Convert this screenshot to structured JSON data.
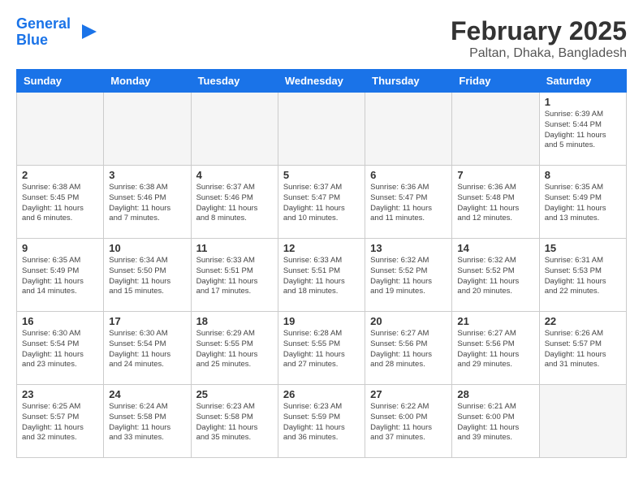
{
  "header": {
    "logo_line1": "General",
    "logo_line2": "Blue",
    "month": "February 2025",
    "location": "Paltan, Dhaka, Bangladesh"
  },
  "weekdays": [
    "Sunday",
    "Monday",
    "Tuesday",
    "Wednesday",
    "Thursday",
    "Friday",
    "Saturday"
  ],
  "weeks": [
    [
      {
        "day": "",
        "info": ""
      },
      {
        "day": "",
        "info": ""
      },
      {
        "day": "",
        "info": ""
      },
      {
        "day": "",
        "info": ""
      },
      {
        "day": "",
        "info": ""
      },
      {
        "day": "",
        "info": ""
      },
      {
        "day": "1",
        "info": "Sunrise: 6:39 AM\nSunset: 5:44 PM\nDaylight: 11 hours and 5 minutes."
      }
    ],
    [
      {
        "day": "2",
        "info": "Sunrise: 6:38 AM\nSunset: 5:45 PM\nDaylight: 11 hours and 6 minutes."
      },
      {
        "day": "3",
        "info": "Sunrise: 6:38 AM\nSunset: 5:46 PM\nDaylight: 11 hours and 7 minutes."
      },
      {
        "day": "4",
        "info": "Sunrise: 6:37 AM\nSunset: 5:46 PM\nDaylight: 11 hours and 8 minutes."
      },
      {
        "day": "5",
        "info": "Sunrise: 6:37 AM\nSunset: 5:47 PM\nDaylight: 11 hours and 10 minutes."
      },
      {
        "day": "6",
        "info": "Sunrise: 6:36 AM\nSunset: 5:47 PM\nDaylight: 11 hours and 11 minutes."
      },
      {
        "day": "7",
        "info": "Sunrise: 6:36 AM\nSunset: 5:48 PM\nDaylight: 11 hours and 12 minutes."
      },
      {
        "day": "8",
        "info": "Sunrise: 6:35 AM\nSunset: 5:49 PM\nDaylight: 11 hours and 13 minutes."
      }
    ],
    [
      {
        "day": "9",
        "info": "Sunrise: 6:35 AM\nSunset: 5:49 PM\nDaylight: 11 hours and 14 minutes."
      },
      {
        "day": "10",
        "info": "Sunrise: 6:34 AM\nSunset: 5:50 PM\nDaylight: 11 hours and 15 minutes."
      },
      {
        "day": "11",
        "info": "Sunrise: 6:33 AM\nSunset: 5:51 PM\nDaylight: 11 hours and 17 minutes."
      },
      {
        "day": "12",
        "info": "Sunrise: 6:33 AM\nSunset: 5:51 PM\nDaylight: 11 hours and 18 minutes."
      },
      {
        "day": "13",
        "info": "Sunrise: 6:32 AM\nSunset: 5:52 PM\nDaylight: 11 hours and 19 minutes."
      },
      {
        "day": "14",
        "info": "Sunrise: 6:32 AM\nSunset: 5:52 PM\nDaylight: 11 hours and 20 minutes."
      },
      {
        "day": "15",
        "info": "Sunrise: 6:31 AM\nSunset: 5:53 PM\nDaylight: 11 hours and 22 minutes."
      }
    ],
    [
      {
        "day": "16",
        "info": "Sunrise: 6:30 AM\nSunset: 5:54 PM\nDaylight: 11 hours and 23 minutes."
      },
      {
        "day": "17",
        "info": "Sunrise: 6:30 AM\nSunset: 5:54 PM\nDaylight: 11 hours and 24 minutes."
      },
      {
        "day": "18",
        "info": "Sunrise: 6:29 AM\nSunset: 5:55 PM\nDaylight: 11 hours and 25 minutes."
      },
      {
        "day": "19",
        "info": "Sunrise: 6:28 AM\nSunset: 5:55 PM\nDaylight: 11 hours and 27 minutes."
      },
      {
        "day": "20",
        "info": "Sunrise: 6:27 AM\nSunset: 5:56 PM\nDaylight: 11 hours and 28 minutes."
      },
      {
        "day": "21",
        "info": "Sunrise: 6:27 AM\nSunset: 5:56 PM\nDaylight: 11 hours and 29 minutes."
      },
      {
        "day": "22",
        "info": "Sunrise: 6:26 AM\nSunset: 5:57 PM\nDaylight: 11 hours and 31 minutes."
      }
    ],
    [
      {
        "day": "23",
        "info": "Sunrise: 6:25 AM\nSunset: 5:57 PM\nDaylight: 11 hours and 32 minutes."
      },
      {
        "day": "24",
        "info": "Sunrise: 6:24 AM\nSunset: 5:58 PM\nDaylight: 11 hours and 33 minutes."
      },
      {
        "day": "25",
        "info": "Sunrise: 6:23 AM\nSunset: 5:58 PM\nDaylight: 11 hours and 35 minutes."
      },
      {
        "day": "26",
        "info": "Sunrise: 6:23 AM\nSunset: 5:59 PM\nDaylight: 11 hours and 36 minutes."
      },
      {
        "day": "27",
        "info": "Sunrise: 6:22 AM\nSunset: 6:00 PM\nDaylight: 11 hours and 37 minutes."
      },
      {
        "day": "28",
        "info": "Sunrise: 6:21 AM\nSunset: 6:00 PM\nDaylight: 11 hours and 39 minutes."
      },
      {
        "day": "",
        "info": ""
      }
    ]
  ]
}
